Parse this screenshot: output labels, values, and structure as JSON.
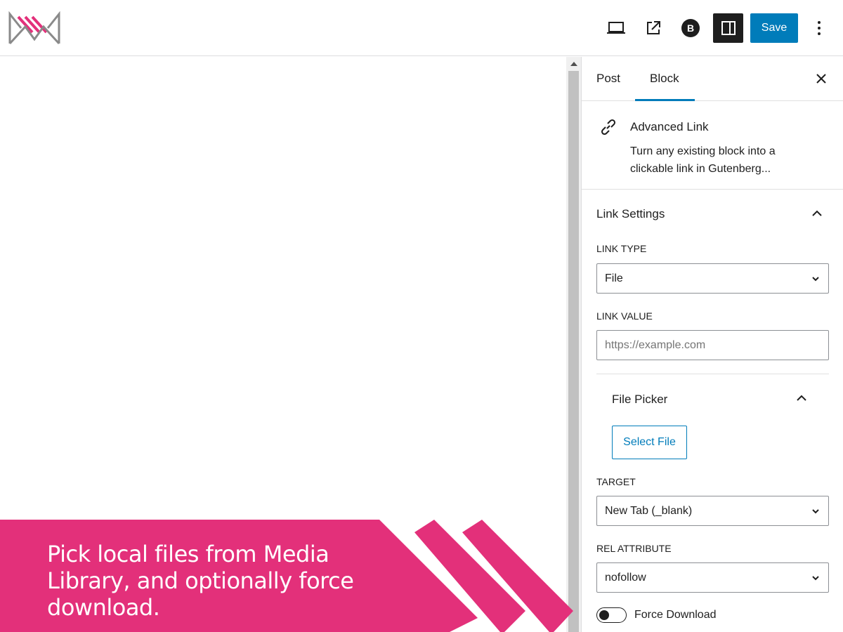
{
  "topbar": {
    "logo_name": "site-logo",
    "preview_icon": "laptop-icon",
    "view_post_icon": "external-link-icon",
    "plugin_icon": "b-circle-icon",
    "sidebar_toggle_icon": "sidebar-icon",
    "save_label": "Save",
    "more_icon": "kebab-menu-icon"
  },
  "sidebar": {
    "tabs": [
      {
        "label": "Post",
        "active": false
      },
      {
        "label": "Block",
        "active": true
      }
    ],
    "close_icon": "close-icon",
    "block": {
      "icon": "link-icon",
      "title": "Advanced Link",
      "description": "Turn any existing block into a clickable link in Gutenberg..."
    },
    "link_settings": {
      "title": "Link Settings",
      "expanded": true,
      "link_type_label": "LINK TYPE",
      "link_type_value": "File",
      "link_value_label": "LINK VALUE",
      "link_value_value": "",
      "link_value_placeholder": "https://example.com",
      "file_picker": {
        "title": "File Picker",
        "expanded": true,
        "button_label": "Select File"
      },
      "target_label": "TARGET",
      "target_value": "New Tab (_blank)",
      "rel_label": "REL ATTRIBUTE",
      "rel_value": "nofollow",
      "force_download_label": "Force Download",
      "force_download_on": false
    }
  },
  "banner": {
    "text": "Pick local files from Media Library, and optionally force download.",
    "color": "#e3307a"
  },
  "colors": {
    "accent": "#007cba",
    "dark": "#1e1e1e",
    "banner_pink": "#e3307a"
  }
}
